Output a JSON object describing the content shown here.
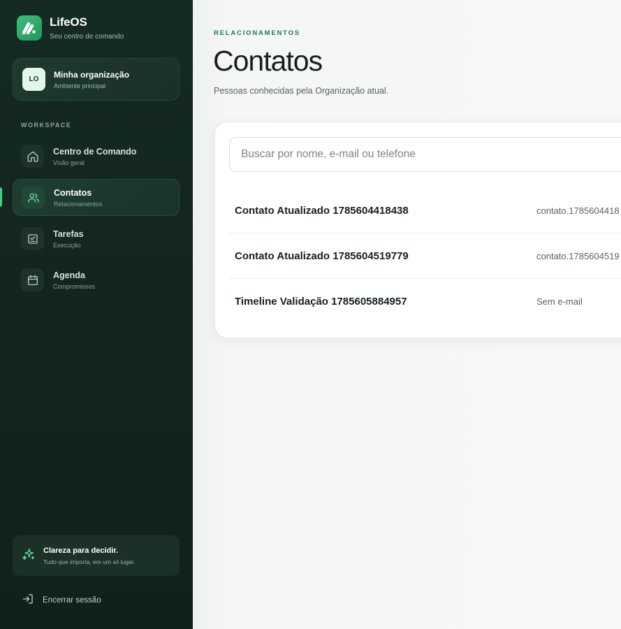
{
  "brand": {
    "name": "LifeOS",
    "tagline": "Seu centro de comando"
  },
  "org": {
    "initials": "LO",
    "name": "Minha organização",
    "sub": "Ambiente principal"
  },
  "sidebar": {
    "section_label": "WORKSPACE",
    "items": [
      {
        "title": "Centro de Comando",
        "sub": "Visão geral",
        "icon": "home-icon",
        "active": false
      },
      {
        "title": "Contatos",
        "sub": "Relacionamentos",
        "icon": "users-icon",
        "active": true
      },
      {
        "title": "Tarefas",
        "sub": "Execução",
        "icon": "checklist-icon",
        "active": false
      },
      {
        "title": "Agenda",
        "sub": "Compromissos",
        "icon": "calendar-icon",
        "active": false
      }
    ],
    "promo": {
      "title": "Clareza para decidir.",
      "sub": "Tudo que importa, em um só lugar."
    },
    "logout_label": "Encerrar sessão"
  },
  "main": {
    "eyebrow": "RELACIONAMENTOS",
    "title": "Contatos",
    "subtitle": "Pessoas conhecidas pela Organização atual.",
    "search": {
      "placeholder": "Buscar por nome, e-mail ou telefone",
      "value": ""
    },
    "contacts": [
      {
        "name": "Contato Atualizado 1785604418438",
        "email": "contato.1785604418"
      },
      {
        "name": "Contato Atualizado 1785604519779",
        "email": "contato.1785604519"
      },
      {
        "name": "Timeline Validação 1785605884957",
        "email": "Sem e-mail"
      }
    ]
  },
  "colors": {
    "accent": "#3fcf85",
    "sidebar_bg": "#142a22",
    "eyebrow": "#1e7a4f"
  }
}
